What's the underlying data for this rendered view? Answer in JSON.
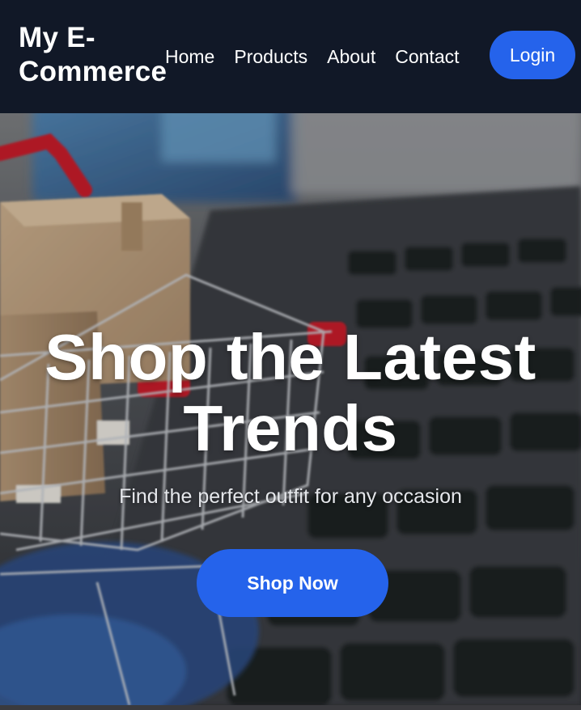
{
  "navbar": {
    "brand": "My E-Commerce",
    "links": [
      {
        "label": "Home"
      },
      {
        "label": "Products"
      },
      {
        "label": "About"
      },
      {
        "label": "Contact"
      }
    ],
    "login_label": "Login"
  },
  "hero": {
    "background": "shopping-cart-with-boxes-on-laptop-keyboard",
    "title": "Shop the Latest Trends",
    "subtitle": "Find the perfect outfit for any occasion",
    "cta_label": "Shop Now"
  },
  "colors": {
    "navbar_bg": "#111827",
    "accent": "#2563eb",
    "text": "#ffffff"
  }
}
